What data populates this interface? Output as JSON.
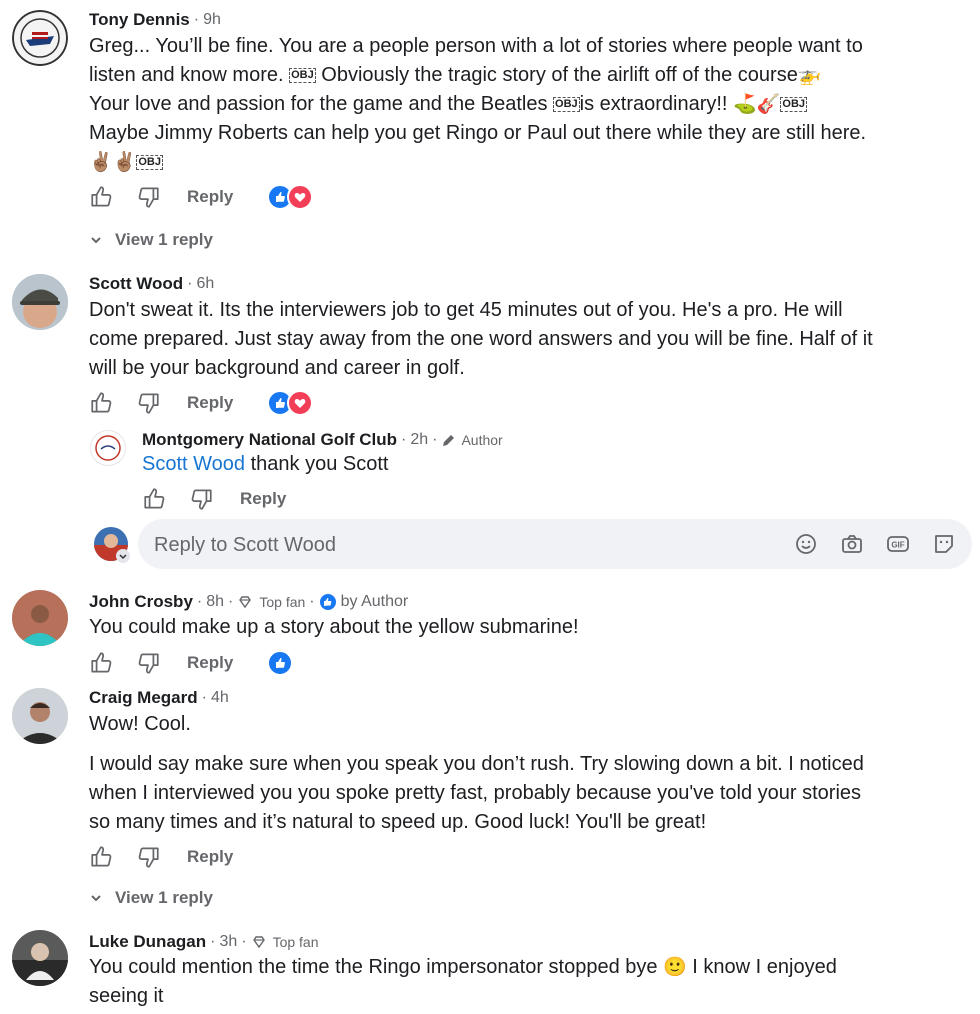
{
  "actions": {
    "reply_label": "Reply",
    "view_reply_label": "View 1 reply"
  },
  "comments": [
    {
      "name": "Tony Dennis",
      "time": "9h",
      "lines": [
        "Greg... You’ll be fine. You are a people person with a lot of stories where people want to",
        "listen and know more. ",
        " Obviously the tragic story of the airlift off of the course",
        "Your love and passion for the game and the Beatles ",
        "is extraordinary!! ",
        "Maybe Jimmy Roberts can help you get Ringo or Paul out there while they are still here."
      ],
      "obj": "OBJ",
      "emoji": {
        "helicopter": "🚁",
        "golf": "⛳",
        "guitar": "🎸",
        "peace": "✌🏽"
      }
    },
    {
      "name": "Scott Wood",
      "time": "6h",
      "lines": [
        "Don't sweat it. Its the interviewers job to get 45 minutes out of you. He's a pro. He will",
        "come prepared. Just stay away from the one word answers and you will be fine. Half of it",
        "will be your background and career in golf."
      ]
    },
    {
      "name": "Montgomery National Golf Club",
      "time": "2h",
      "badge": "Author",
      "mention": "Scott Wood",
      "text": " thank you Scott"
    },
    {
      "name": "John Crosby",
      "time": "8h",
      "badge": "Top fan",
      "reaction_by": "by Author",
      "text": "You could make up a story about the yellow submarine!"
    },
    {
      "name": "Craig Megard",
      "time": "4h",
      "text": "Wow! Cool.",
      "lines": [
        "I would say make sure when you speak you don’t rush. Try slowing down a bit. I noticed",
        "when I interviewed you you spoke pretty fast, probably because you've told your stories",
        "so many times and it’s natural to speed up. Good luck! You'll be great!"
      ]
    },
    {
      "name": "Luke Dunagan",
      "time": "3h",
      "badge": "Top fan",
      "text": "You could mention the time the Ringo impersonator stopped bye ",
      "text2": " I know I enjoyed",
      "line2": "seeing it",
      "emoji": "🙂"
    }
  ],
  "reply_box": {
    "placeholder": "Reply to Scott Wood"
  },
  "colors": {
    "like": "#1877f2",
    "love": "#f33e58",
    "link": "#1876d2",
    "secondary": "#65676b"
  }
}
